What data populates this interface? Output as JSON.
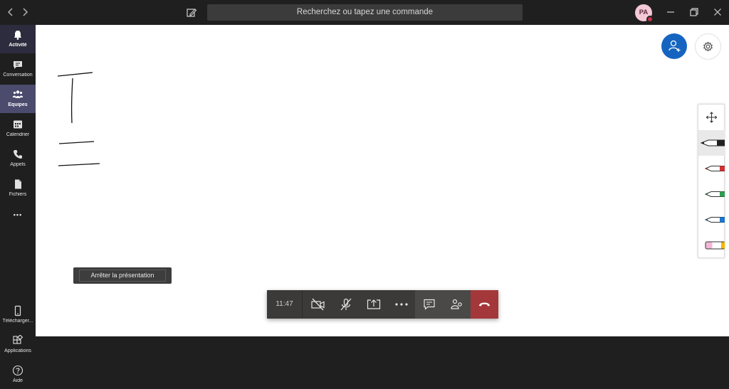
{
  "topbar": {
    "search_placeholder": "Recherchez ou tapez une commande",
    "avatar_initials": "PA",
    "icons": [
      "back-arrow-icon",
      "forward-arrow-icon",
      "compose-icon",
      "minimize-icon",
      "restore-icon",
      "close-icon"
    ]
  },
  "rail": {
    "items": [
      {
        "label": "Activité",
        "icon": "bell-icon"
      },
      {
        "label": "Conversation",
        "icon": "chat-icon"
      },
      {
        "label": "Équipes",
        "icon": "teams-icon"
      },
      {
        "label": "Calendrier",
        "icon": "calendar-icon"
      },
      {
        "label": "Appels",
        "icon": "phone-icon"
      },
      {
        "label": "Fichiers",
        "icon": "file-icon"
      }
    ],
    "more": "•••",
    "bottom": [
      {
        "label": "Télécharger...",
        "icon": "mobile-icon"
      },
      {
        "label": "Applications",
        "icon": "apps-icon"
      },
      {
        "label": "Aide",
        "icon": "help-icon"
      }
    ]
  },
  "presentation": {
    "stop_label": "Arrêter la présentation"
  },
  "callbar": {
    "time": "11:47"
  },
  "colors": {
    "accent": "#1565c0",
    "hangup": "#a4373a",
    "presence": "#c4314b",
    "rail_selected": "#4b4b6e"
  },
  "whiteboard": {
    "pens": [
      "black-pen-icon",
      "red-pen-icon",
      "green-pen-icon",
      "blue-pen-icon",
      "highlighter-icon"
    ]
  }
}
